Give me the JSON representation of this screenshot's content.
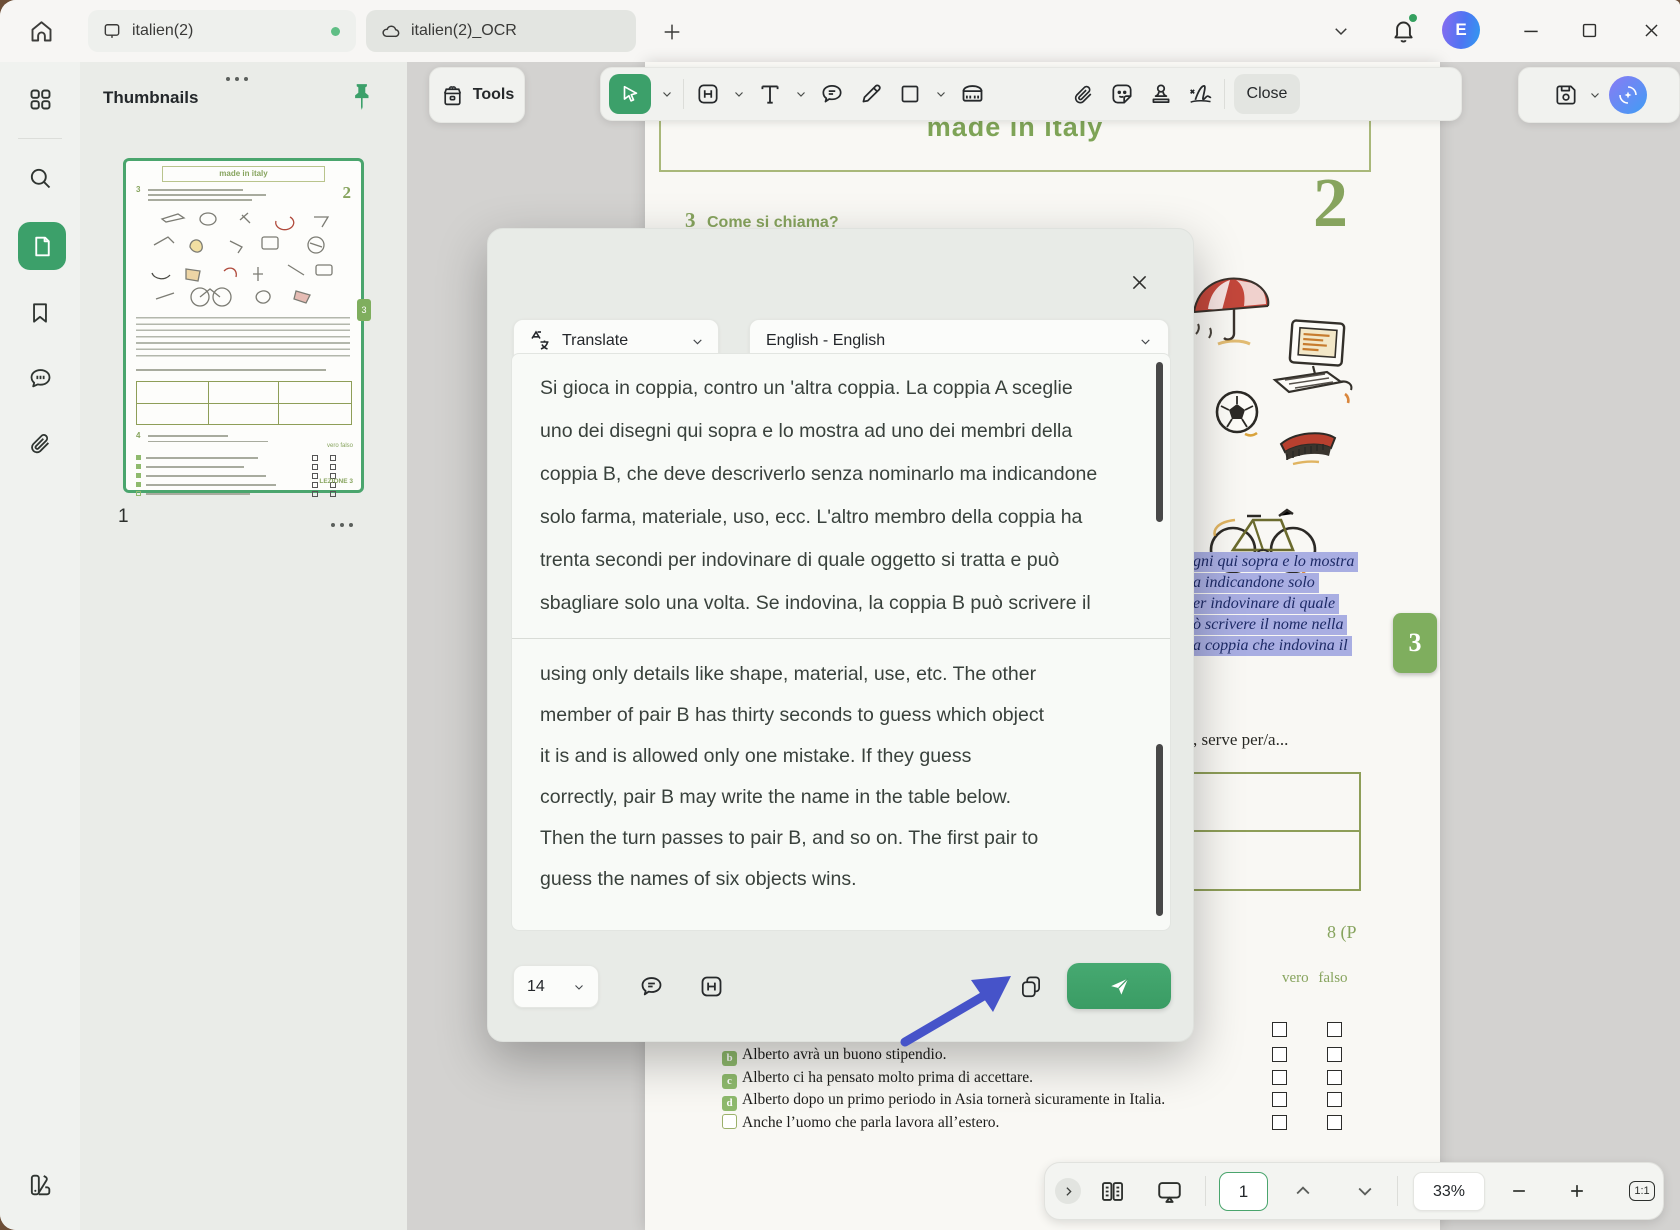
{
  "window": {
    "tabs": [
      {
        "label": "italien(2)"
      },
      {
        "label": "italien(2)_OCR"
      }
    ],
    "avatar_initial": "E"
  },
  "sidebar_panel": {
    "title": "Thumbnails",
    "page_number": "1"
  },
  "toolbar": {
    "tools_label": "Tools",
    "close_label": "Close"
  },
  "dialog": {
    "mode_label": "Translate",
    "language_pair": "English - English",
    "font_size": "14",
    "source_lines": [
      "Si gioca in coppia, contro un 'altra coppia. La coppia A sceglie",
      "uno dei disegni qui sopra e lo mostra ad uno dei membri della",
      "coppia B, che deve descriverlo senza nominarlo ma indicandone",
      "solo farma, materiale, uso, ecc. L'altro membro della coppia ha",
      "trenta secondi per indovinare di quale oggetto si tratta e può",
      "sbagliare solo una volta. Se indovina, la coppia B può scrivere il"
    ],
    "translated_lines": [
      "using only details like shape, material, use, etc. The other",
      "member of pair B has thirty seconds to guess which object",
      "it is and is allowed only one mistake. If they guess",
      "correctly, pair B may write the name in the table below.",
      "Then the turn passes to pair B, and so on. The first pair to",
      "guess the names of six objects wins."
    ]
  },
  "document": {
    "title": "made in italy",
    "section_number": "3",
    "section_heading": "Come si chiama?",
    "page_number_large": "2",
    "side_tab": "3",
    "highlight_lines": [
      "gni qui sopra e lo mostra",
      "a indicandone solo",
      "er indovinare di quale",
      "ò scrivere il nome nella",
      "a coppia che indovina il"
    ],
    "serve_line": ", serve per/a...",
    "page_ref": "8 (P",
    "truth_header": "vero falso",
    "items": [
      {
        "badge": "b",
        "text": "Alberto avrà un buono stipendio."
      },
      {
        "badge": "c",
        "text": "Alberto ci ha pensato molto prima di accettare."
      },
      {
        "badge": "d",
        "text": "Alberto dopo un primo periodo in Asia tornerà sicuramente in Italia."
      },
      {
        "badge": "",
        "text": "Anche l’uomo che parla lavora all’estero."
      }
    ]
  },
  "thumbnail": {
    "title": "made in italy",
    "corner_number": "2",
    "side_tab": "3",
    "footer_label": "LEZIONE 3"
  },
  "status_bar": {
    "page": "1",
    "zoom_level": "33%",
    "fit_label": "1:1"
  },
  "colors": {
    "accent_green": "#3ca06a",
    "doc_green": "#87a45e",
    "highlight_blue": "#a9aee2",
    "arrow_blue": "#4653c9"
  }
}
